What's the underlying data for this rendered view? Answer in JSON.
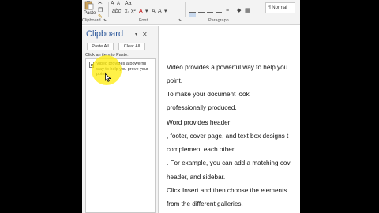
{
  "ribbon": {
    "paste_label": "Paste",
    "clipboard_group": "Clipboard",
    "font_group": "Font",
    "paragraph_group": "Paragraph",
    "style_normal": "Normal",
    "pilcrow": "¶"
  },
  "clipboard_pane": {
    "title": "Clipboard",
    "paste_all": "Paste All",
    "clear_all": "Clear All",
    "hint": "Click an item to Paste:",
    "items": [
      {
        "text": "Video provides a powerful way to help you prove your point."
      }
    ]
  },
  "document": {
    "lines": [
      "Video provides a powerful way to help you",
      " point.",
      "To make your document look",
      "professionally produced,",
      " Word provides header",
      ", footer, cover page, and text box designs t",
      " complement each other",
      ". For example, you can add a matching cov",
      " header, and sidebar.",
      "Click Insert and then choose the elements",
      " from the different galleries."
    ]
  },
  "colors": {
    "accent": "#2b579a",
    "highlight": "#ffec00"
  }
}
